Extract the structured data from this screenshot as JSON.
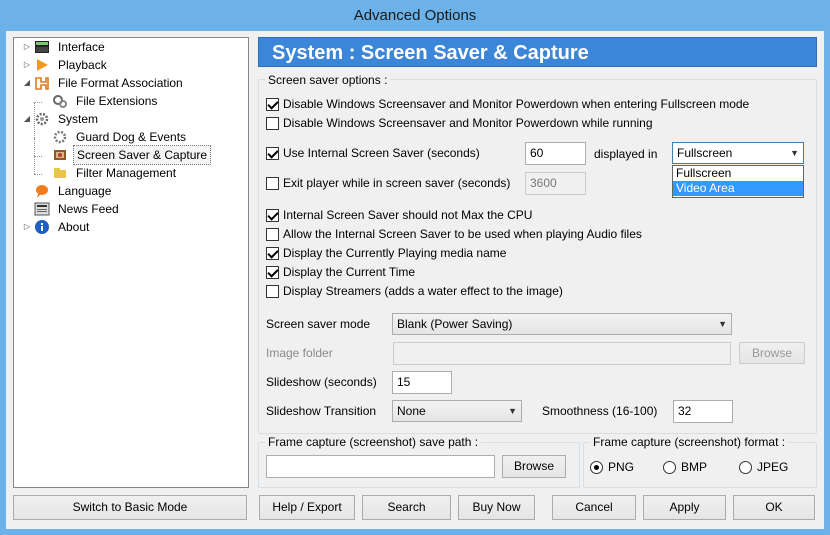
{
  "window": {
    "title": "Advanced Options"
  },
  "tree": {
    "items": [
      {
        "label": "Interface",
        "icon": "interface-icon"
      },
      {
        "label": "Playback",
        "icon": "playback-icon"
      },
      {
        "label": "File Format Association",
        "icon": "file-format-icon"
      },
      {
        "label": "File Extensions",
        "icon": "file-extensions-icon"
      },
      {
        "label": "System",
        "icon": "system-gear-icon"
      },
      {
        "label": "Guard Dog & Events",
        "icon": "guard-dog-icon"
      },
      {
        "label": "Screen Saver & Capture",
        "icon": "screen-saver-icon"
      },
      {
        "label": "Filter Management",
        "icon": "filter-icon"
      },
      {
        "label": "Language",
        "icon": "language-icon"
      },
      {
        "label": "News Feed",
        "icon": "news-icon"
      },
      {
        "label": "About",
        "icon": "info-icon"
      }
    ]
  },
  "panel": {
    "title": "System : Screen Saver & Capture",
    "screensaver_group": "Screen saver options :",
    "opt_disable_fullscreen": "Disable Windows Screensaver and Monitor Powerdown when entering Fullscreen mode",
    "opt_disable_running": "Disable Windows Screensaver and Monitor Powerdown while running",
    "opt_use_internal": "Use Internal Screen Saver (seconds)",
    "internal_seconds": "60",
    "displayed_in": "displayed in",
    "display_selected": "Fullscreen",
    "display_options": [
      "Fullscreen",
      "Video Area"
    ],
    "opt_exit_player": "Exit player while in screen saver (seconds)",
    "exit_seconds": "3600",
    "opt_no_max_cpu": "Internal Screen Saver should not Max the CPU",
    "opt_allow_audio": "Allow the Internal Screen Saver to be used when playing Audio files",
    "opt_display_media": "Display the Currently Playing media name",
    "opt_display_time": "Display the Current Time",
    "opt_display_streamers": "Display Streamers (adds a water effect to the image)",
    "mode_label": "Screen saver mode",
    "mode_value": "Blank (Power Saving)",
    "image_folder_label": "Image folder",
    "image_folder_value": "",
    "browse_label": "Browse",
    "slideshow_label": "Slideshow (seconds)",
    "slideshow_value": "15",
    "transition_label": "Slideshow Transition",
    "transition_value": "None",
    "smoothness_label": "Smoothness (16-100)",
    "smoothness_value": "32",
    "capture_path_group": "Frame capture (screenshot) save path :",
    "capture_path_value": "",
    "capture_browse": "Browse",
    "capture_format_group": "Frame capture (screenshot) format :",
    "formats": [
      "PNG",
      "BMP",
      "JPEG"
    ]
  },
  "buttons": {
    "basic_mode": "Switch to Basic Mode",
    "help": "Help / Export",
    "search": "Search",
    "buy": "Buy Now",
    "cancel": "Cancel",
    "apply": "Apply",
    "ok": "OK"
  }
}
